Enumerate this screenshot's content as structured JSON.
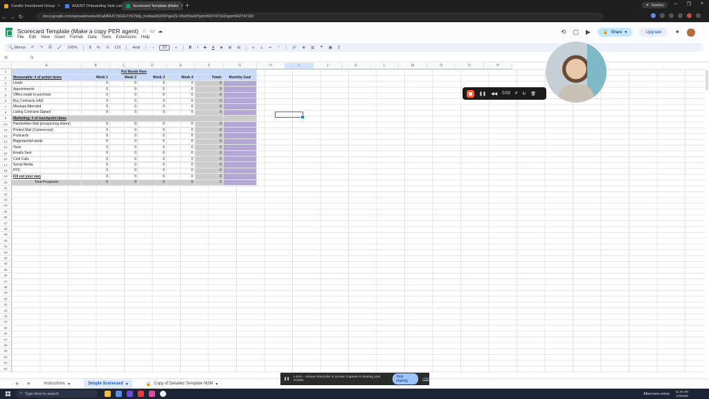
{
  "browser": {
    "tabs": [
      {
        "label": "Condor Investment Group",
        "color": "#e8a33d",
        "active": false
      },
      {
        "label": "AGENT Onboarding Task List",
        "color": "#4285f4",
        "active": false
      },
      {
        "label": "Scorecard Template (Make",
        "color": "#0f9d58",
        "active": true
      }
    ],
    "new_tab": "+",
    "gemini_label": "Gemini",
    "url": "docs.google.com/spreadsheets/d/1aMRUCYj/GGYXS7Wg_hni0wsRQ0FPgH2S-V8z83/edit?gid=842747192#gid=842747192"
  },
  "sheets": {
    "title": "Scorecard Template (Make a copy PER agent)",
    "menu": [
      "File",
      "Edit",
      "View",
      "Insert",
      "Format",
      "Data",
      "Tools",
      "Extensions",
      "Help"
    ],
    "share_label": "Share",
    "upgrade_label": "Upgrade",
    "toolbar": {
      "menus": "Menus",
      "zoom": "100%",
      "currency": "$",
      "percent": "%",
      "decimals": ".0",
      "format": "123",
      "font": "Arial",
      "font_size": "10"
    },
    "namebox": "I6",
    "fx": "fx"
  },
  "columns": [
    "A",
    "B",
    "C",
    "D",
    "E",
    "F",
    "G",
    "H",
    "I",
    "J",
    "K",
    "L",
    "M",
    "N",
    "O",
    "P"
  ],
  "table": {
    "header_month": "Put Month Here",
    "measurable_title": "Measurable: # of action items",
    "week_labels": [
      "Week 1",
      "Week 2",
      "Week 3",
      "Week 4"
    ],
    "totals_label": "Totals",
    "goal_label": "Monthly Goal",
    "section1": [
      "Leads",
      "Appointments",
      "Offers made to purchase",
      "Buy Contracts UAG",
      "Meetups Attended",
      "Listing Contracts Signed"
    ],
    "marketing_title": "Marketing: # of touchpoint ideas",
    "section2": [
      "Handwritten Mail (prospecting letters)",
      "Printed Mail (Commercial)",
      "Postcards",
      "Biggerpocket posts",
      "Texts",
      "Emails Sent",
      "Cold Calls",
      "Social Media",
      "PPC"
    ],
    "fill_own": "Fill out your own",
    "total_prospects": "Total Prospects",
    "zero": "0"
  },
  "loom": {
    "timer": "0:02"
  },
  "sheet_tabs": [
    {
      "label": "Instructions",
      "active": false
    },
    {
      "label": "Simple Scorecard",
      "active": true
    },
    {
      "label": "Copy of Detailed Template M2M",
      "active": false
    }
  ],
  "share_notice": {
    "text": "Loom – Screen Recorder & Screen Capture is sharing your screen.",
    "stop": "Stop sharing",
    "hide": "Hide"
  },
  "taskbar": {
    "search": "Type here to search",
    "weather": "Afternoon snow",
    "time": "11:18 AM",
    "date": "1/3/2026"
  }
}
